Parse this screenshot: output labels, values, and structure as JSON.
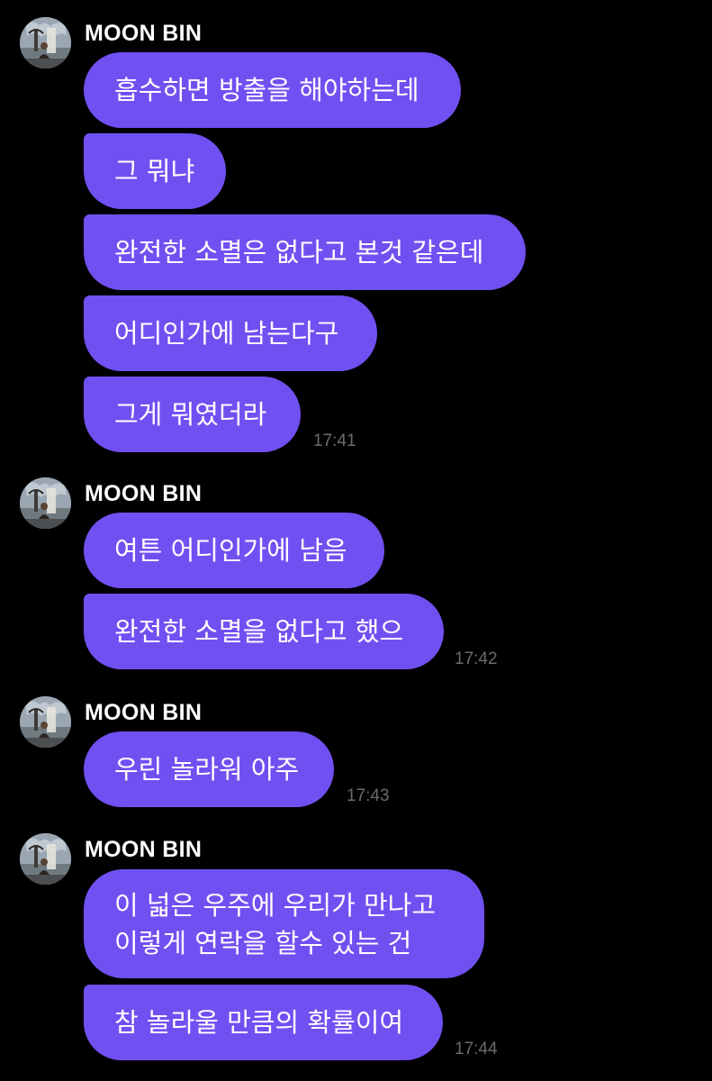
{
  "messages": [
    {
      "sender": "MOON BIN",
      "avatar_icon": "profile-photo",
      "bubbles": [
        "흡수하면 방출을 해야하는데",
        "그 뭐냐",
        "완전한 소멸은 없다고 본것 같은데",
        "어디인가에 남는다구",
        "그게 뭐였더라"
      ],
      "time": "17:41"
    },
    {
      "sender": "MOON BIN",
      "avatar_icon": "profile-photo",
      "bubbles": [
        "여튼 어디인가에 남음",
        "완전한 소멸을 없다고 했으"
      ],
      "time": "17:42"
    },
    {
      "sender": "MOON BIN",
      "avatar_icon": "profile-photo",
      "bubbles": [
        "우린 놀라워 아주"
      ],
      "time": "17:43"
    },
    {
      "sender": "MOON BIN",
      "avatar_icon": "profile-photo",
      "bubbles": [
        "이 넓은 우주에 우리가 만나고\n이렇게 연락을 할수 있는 건",
        "참 놀라울 만큼의 확률이여"
      ],
      "time": "17:44"
    }
  ],
  "colors": {
    "background": "#000000",
    "bubble": "#7150f2",
    "bubble_text": "#ffffff",
    "sender_text": "#ffffff",
    "timestamp": "#6b6b6b"
  }
}
